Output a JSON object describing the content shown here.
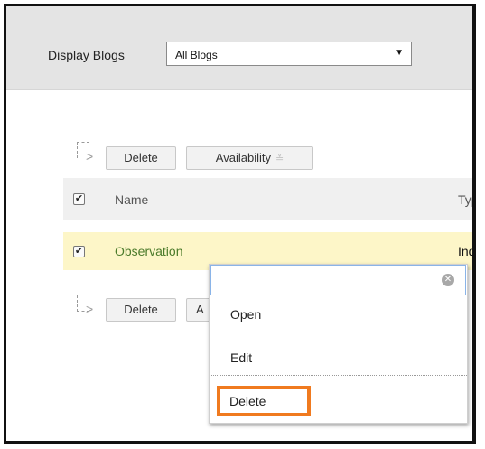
{
  "filter": {
    "label": "Display Blogs",
    "selected": "All Blogs"
  },
  "toolbar_top": {
    "delete": "Delete",
    "availability": "Availability"
  },
  "toolbar_bottom": {
    "delete": "Delete",
    "partial": "A"
  },
  "table": {
    "columns": [
      "Name",
      "Typ"
    ],
    "rows": [
      {
        "name": "Observation",
        "type": "Indi",
        "checked": true
      }
    ]
  },
  "context_menu": {
    "items": [
      "Open",
      "Edit",
      "Delete"
    ],
    "highlighted": "Delete",
    "highlight_color": "#f07a1f"
  }
}
